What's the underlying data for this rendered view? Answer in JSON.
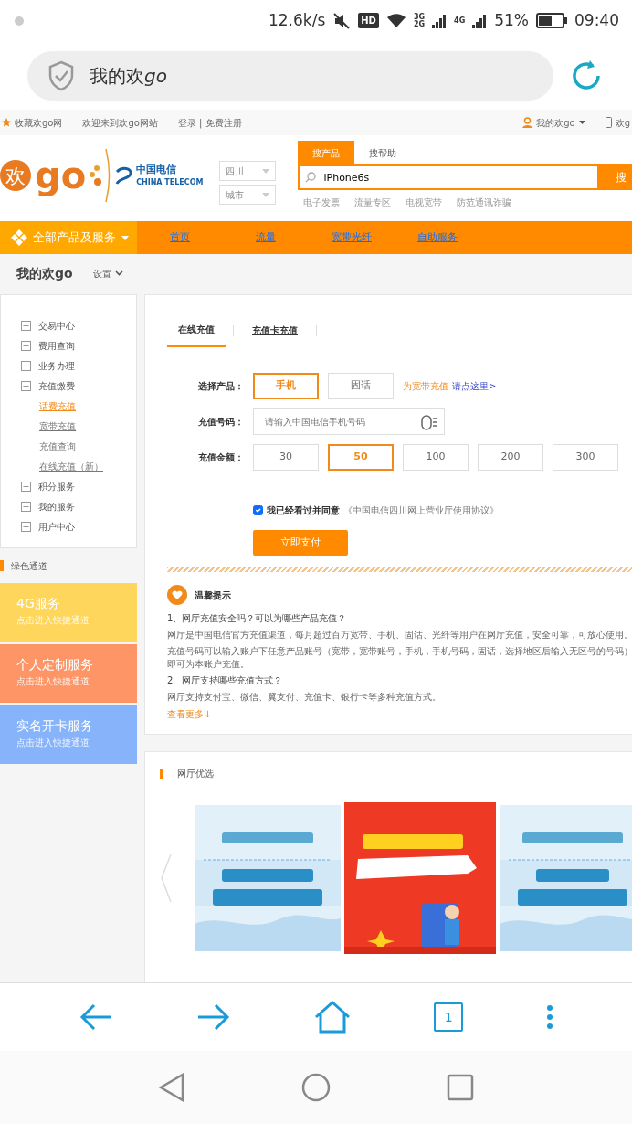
{
  "status_bar": {
    "speed": "12.6k/s",
    "hd": "HD",
    "network_a": "3G",
    "network_b": "2G",
    "network_c": "4G",
    "battery": "51%",
    "time": "09:40"
  },
  "address_bar": {
    "title": "我的欢",
    "title_latin": "go"
  },
  "site_top": {
    "links": [
      "收藏欢go网",
      "欢迎来到欢go网站",
      "登录 | 免费注册"
    ],
    "account": "我的欢go",
    "mobile": "欢g"
  },
  "header": {
    "logo_mark": "欢",
    "logo_word": "go",
    "partner": "中国电信",
    "partner_en": "CHINA TELECOM",
    "province": "四川",
    "city": "城市",
    "search_tabs": [
      {
        "label": "搜产品",
        "selected": true
      },
      {
        "label": "搜帮助",
        "selected": false
      }
    ],
    "search_value": "iPhone6s",
    "search_button": "搜",
    "hot_links": [
      "电子发票",
      "流量专区",
      "电视宽带",
      "防范通讯诈骗"
    ]
  },
  "nav": {
    "all": "全部产品及服务",
    "items": [
      "首页",
      "流量",
      "宽带光纤",
      "自助服务"
    ]
  },
  "breadcrumb": {
    "title": "我的欢go",
    "settings": "设置"
  },
  "sidebar": {
    "items": [
      {
        "label": "交易中心",
        "expanded": false
      },
      {
        "label": "费用查询",
        "expanded": false
      },
      {
        "label": "业务办理",
        "expanded": false
      },
      {
        "label": "充值缴费",
        "expanded": true,
        "children": [
          {
            "label": "话费充值",
            "selected": true
          },
          {
            "label": "宽带充值",
            "selected": false
          },
          {
            "label": "充值查询",
            "selected": false
          },
          {
            "label": "在线充值（新）",
            "selected": false
          }
        ]
      },
      {
        "label": "积分服务",
        "expanded": false
      },
      {
        "label": "我的服务",
        "expanded": false
      },
      {
        "label": "用户中心",
        "expanded": false
      }
    ]
  },
  "green_channel": {
    "title": "绿色通道",
    "tiles": [
      {
        "title": "4G服务",
        "subtitle": "点击进入快捷通道",
        "color": "#fed65c"
      },
      {
        "title": "个人定制服务",
        "subtitle": "点击进入快捷通道",
        "color": "#fe9566"
      },
      {
        "title": "实名开卡服务",
        "subtitle": "点击进入快捷通道",
        "color": "#86b3f9"
      }
    ]
  },
  "recharge": {
    "tabs": [
      {
        "label": "在线充值",
        "selected": true
      },
      {
        "label": "充值卡充值",
        "selected": false
      }
    ],
    "product_label": "选择产品：",
    "products": [
      {
        "label": "手机",
        "selected": true
      },
      {
        "label": "固话",
        "selected": false
      }
    ],
    "broadband_note": "为宽带充值",
    "broadband_link": "请点这里>",
    "number_label": "充值号码：",
    "number_placeholder": "请输入中国电信手机号码",
    "amount_label": "充值金额：",
    "amounts": [
      {
        "label": "30",
        "selected": false
      },
      {
        "label": "50",
        "selected": true
      },
      {
        "label": "100",
        "selected": false
      },
      {
        "label": "200",
        "selected": false
      },
      {
        "label": "300",
        "selected": false
      }
    ],
    "agree": {
      "checked": true,
      "text": "我已经看过并同意",
      "link": "《中国电信四川网上营业厅使用协议》"
    },
    "pay_button": "立即支付"
  },
  "tips": {
    "title": "温馨提示",
    "lines": [
      {
        "kind": "question",
        "text": "1、网厅充值安全吗？可以为哪些产品充值？"
      },
      {
        "kind": "answer",
        "text": "网厅是中国电信官方充值渠道，每月超过百万宽带、手机、固话、光纤等用户在网厅充值，安全可靠，可放心使用。"
      },
      {
        "kind": "answer",
        "text": "充值号码可以输入账户下任意产品账号（宽带，宽带账号，手机，手机号码，固话，选择地区后输入无区号的号码）即可为本账户充值。"
      },
      {
        "kind": "question",
        "text": "2、网厅支持哪些充值方式？"
      },
      {
        "kind": "answer",
        "text": "网厅支持支付宝、微信、翼支付、充值卡、银行卡等多种充值方式。"
      }
    ],
    "more": "查看更多↓"
  },
  "featured": {
    "title": "网厅优选"
  },
  "browser_toolbar": {
    "tab_count": "1"
  }
}
